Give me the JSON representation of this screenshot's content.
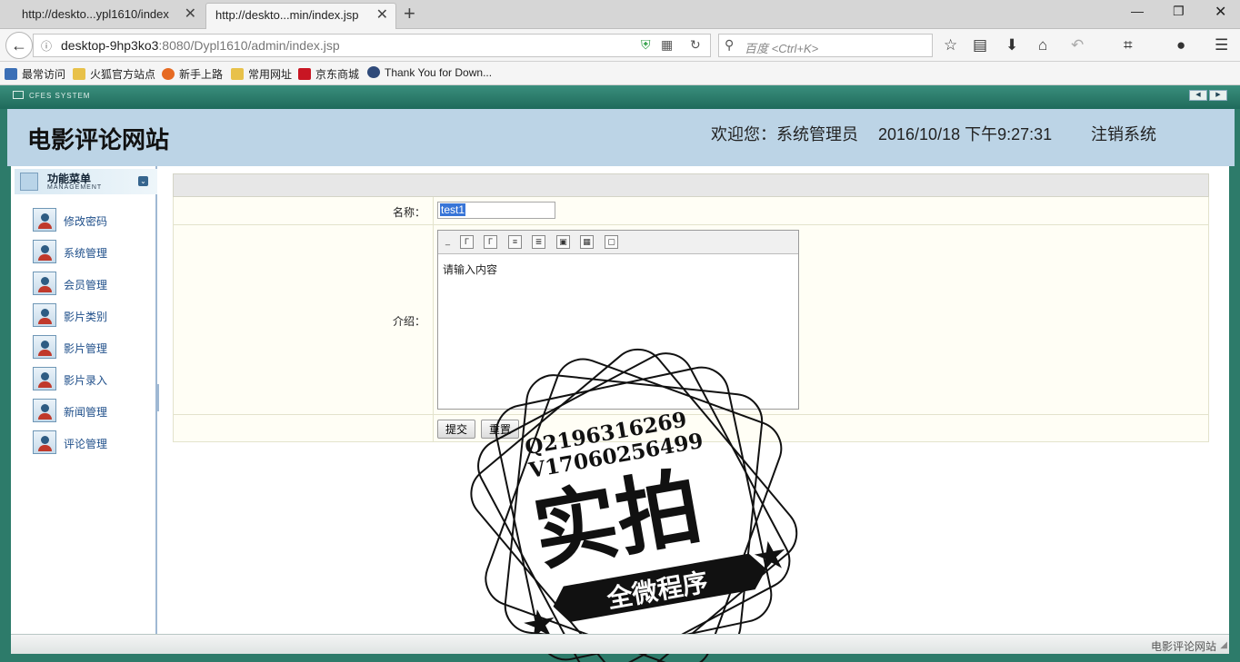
{
  "browser": {
    "tabs": [
      {
        "title": "http://deskto...ypl1610/index",
        "active": false
      },
      {
        "title": "http://deskto...min/index.jsp",
        "active": true
      }
    ],
    "new_tab": "+",
    "url_host": "desktop-9hp3ko3",
    "url_rest": ":8080/Dypl1610/admin/index.jsp",
    "search_placeholder": "百度 <Ctrl+K>",
    "bookmarks": [
      {
        "label": "最常访问",
        "color": "#3b6fb6"
      },
      {
        "label": "火狐官方站点",
        "color": "#e8c14a"
      },
      {
        "label": "新手上路",
        "color": "#e66a22"
      },
      {
        "label": "常用网址",
        "color": "#e8c14a"
      },
      {
        "label": "京东商城",
        "color": "#c81623"
      },
      {
        "label": "Thank You for Down...",
        "color": "#2f4a7a"
      }
    ]
  },
  "frame": {
    "system_label": "CFES SYSTEM"
  },
  "header": {
    "site_title": "电影评论网站",
    "welcome": "欢迎您：系统管理员",
    "datetime": "2016/10/18 下午9:27:31",
    "logout": "注销系统"
  },
  "sidebar": {
    "title": "功能菜单",
    "subtitle": "MANAGEMENT",
    "items": [
      {
        "label": "修改密码"
      },
      {
        "label": "系统管理"
      },
      {
        "label": "会员管理"
      },
      {
        "label": "影片类别"
      },
      {
        "label": "影片管理"
      },
      {
        "label": "影片录入"
      },
      {
        "label": "新闻管理"
      },
      {
        "label": "评论管理"
      }
    ]
  },
  "form": {
    "name_label": "名称：",
    "name_value": "test1",
    "intro_label": "介绍：",
    "intro_placeholder": "请输入内容",
    "submit_label": "提交",
    "reset_label": "重置"
  },
  "watermark": {
    "line1": "Q2196316269",
    "line2": "V17060256499",
    "main": "实拍",
    "banner": "全微程序"
  },
  "status": {
    "footer": "电影评论网站"
  },
  "colors": {
    "frame": "#2d7b6a",
    "header": "#bcd4e6",
    "menu_link": "#1f4f8a"
  }
}
